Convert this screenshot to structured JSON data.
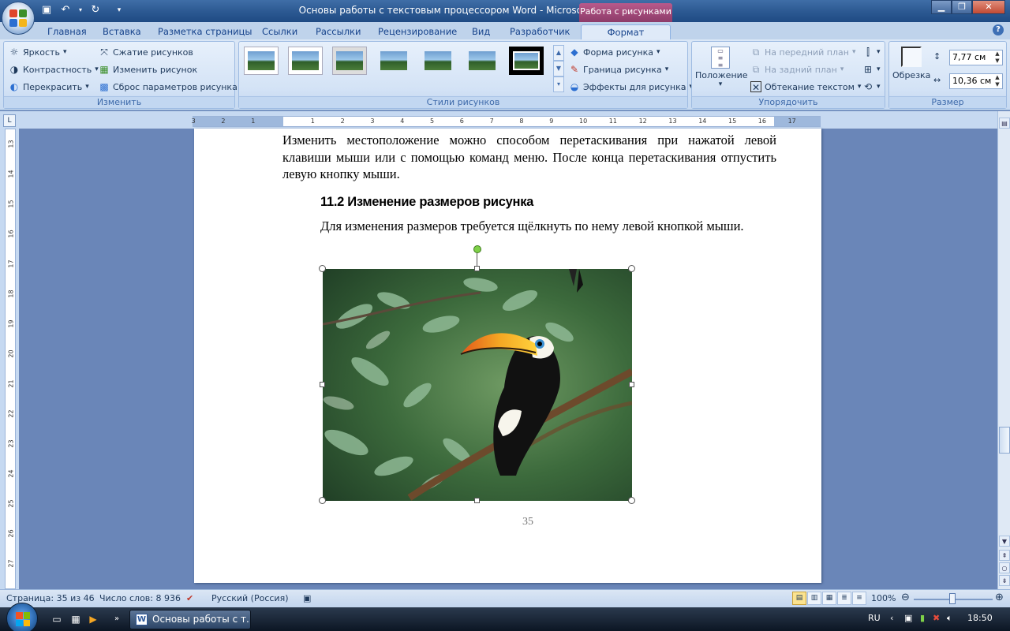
{
  "window": {
    "title": "Основы работы с текстовым процессором Word - Microsoft Word",
    "context_tab_title": "Работа с рисунками"
  },
  "tabs": [
    "Главная",
    "Вставка",
    "Разметка страницы",
    "Ссылки",
    "Рассылки",
    "Рецензирование",
    "Вид",
    "Разработчик",
    "Формат"
  ],
  "ribbon": {
    "adjust": {
      "label": "Изменить",
      "brightness": "Яркость",
      "contrast": "Контрастность",
      "recolor": "Перекрасить",
      "compress": "Сжатие рисунков",
      "change": "Изменить рисунок",
      "reset": "Сброс параметров рисунка"
    },
    "styles": {
      "label": "Стили рисунков",
      "shape": "Форма рисунка",
      "border": "Граница рисунка",
      "effects": "Эффекты для рисунка"
    },
    "arrange": {
      "label": "Упорядочить",
      "position": "Положение",
      "bring_front": "На передний план",
      "send_back": "На задний план",
      "wrap": "Обтекание текстом"
    },
    "size": {
      "label": "Размер",
      "crop": "Обрезка",
      "height": "7,77 см",
      "width": "10,36 см"
    }
  },
  "ruler": {
    "h_ticks": [
      "3",
      "2",
      "1",
      "1",
      "2",
      "3",
      "4",
      "5",
      "6",
      "7",
      "8",
      "9",
      "10",
      "11",
      "12",
      "13",
      "14",
      "15",
      "16",
      "17"
    ],
    "v_ticks": [
      "13",
      "14",
      "15",
      "16",
      "17",
      "18",
      "19",
      "20",
      "21",
      "22",
      "23",
      "24",
      "25",
      "26",
      "27"
    ]
  },
  "document": {
    "para1": "Изменить местоположение можно способом перетаскивания при нажатой левой клавиши мыши или с помощью команд меню. После конца перетаскивания отпустить левую кнопку мыши.",
    "heading": "11.2 Изменение размеров рисунка",
    "para2": "Для изменения размеров требуется щёлкнуть по нему левой кнопкой мыши.",
    "page_number": "35"
  },
  "status": {
    "page": "Страница: 35 из 46",
    "words": "Число слов: 8 936",
    "language": "Русский (Россия)",
    "zoom": "100%"
  },
  "taskbar": {
    "task": "Основы работы с т...",
    "lang": "RU",
    "time": "18:50"
  }
}
